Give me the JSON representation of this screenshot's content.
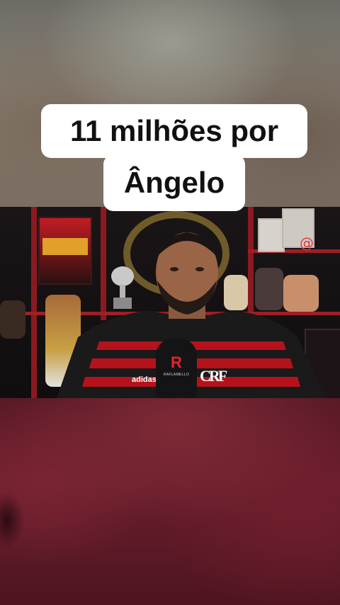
{
  "caption": {
    "line1": "11 milhões por",
    "line2": "Ângelo"
  },
  "video": {
    "mic_logo": "R",
    "mic_brand": "RAFLAMELLO",
    "shirt_brand": "adidas",
    "shirt_crest": "CRF",
    "at_symbol": "@"
  },
  "colors": {
    "flamengo_red": "#c8102e",
    "flamengo_black": "#111111",
    "caption_bg": "#ffffff",
    "caption_text": "#111111"
  }
}
